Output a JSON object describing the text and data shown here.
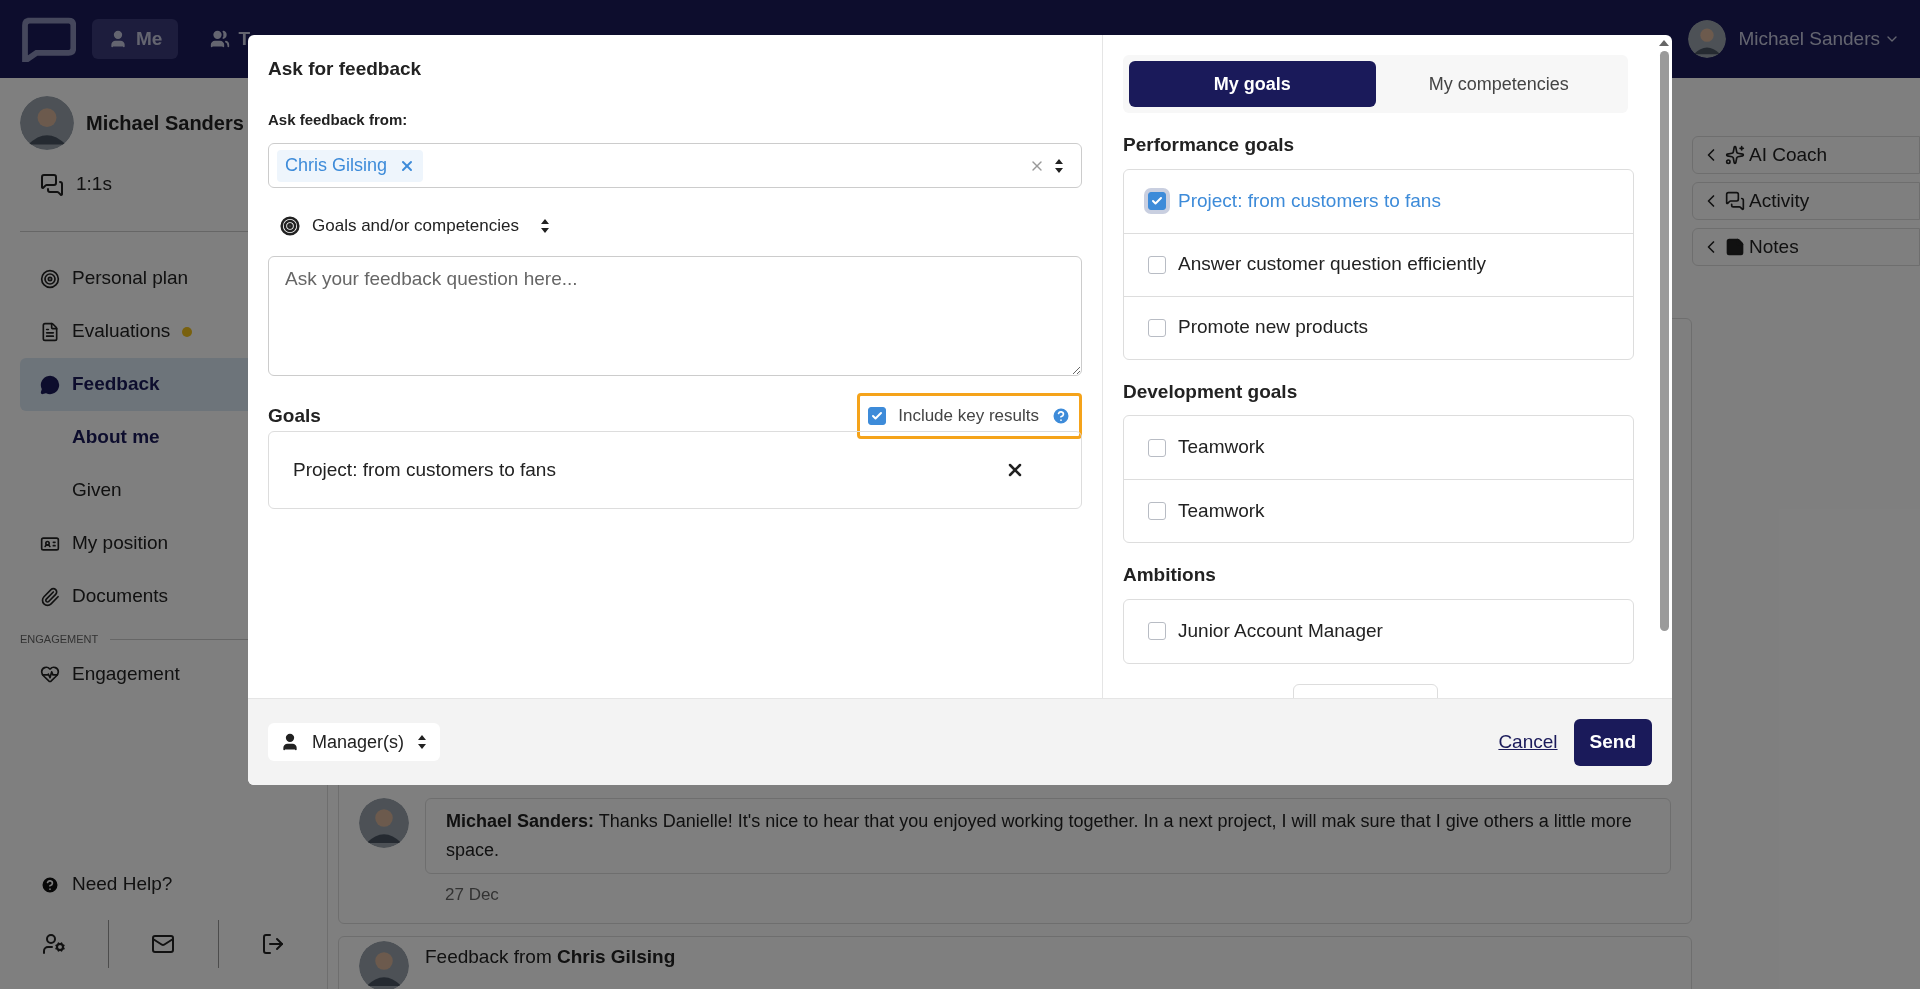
{
  "top_nav": {
    "tabs": [
      {
        "label": "Me",
        "kind": "me",
        "selected": true
      },
      {
        "label": "T",
        "kind": "team",
        "selected": false
      }
    ],
    "user": {
      "name": "Michael Sanders"
    }
  },
  "sidebar": {
    "profile": {
      "name": "Michael Sanders"
    },
    "top_item": {
      "label": "1:1s",
      "kind": "chats"
    },
    "items": [
      {
        "label": "Personal plan",
        "kind": "target",
        "selected": false,
        "notification": false
      },
      {
        "label": "Evaluations",
        "kind": "file",
        "selected": false,
        "notification": true
      },
      {
        "label": "Feedback",
        "kind": "chat",
        "selected": true,
        "notification": false,
        "children": [
          {
            "label": "About me",
            "selected": true
          },
          {
            "label": "Given",
            "selected": false
          }
        ]
      },
      {
        "label": "My position",
        "kind": "id",
        "selected": false,
        "notification": false
      },
      {
        "label": "Documents",
        "kind": "clip",
        "selected": false,
        "notification": false
      }
    ],
    "section_label": "ENGAGEMENT",
    "section_items": [
      {
        "label": "Engagement",
        "kind": "heart",
        "selected": false,
        "notification": false
      }
    ],
    "help": "Need Help?"
  },
  "side_panels": [
    {
      "label": "AI Coach",
      "kind": "sparkles"
    },
    {
      "label": "Activity",
      "kind": "chats"
    },
    {
      "label": "Notes",
      "kind": "note"
    }
  ],
  "comment": {
    "author": "Michael Sanders:",
    "text": "Thanks Danielle! It's nice to hear that you enjoyed working together. In a next project, I will mak sure that I give others a little more space.",
    "date": "27 Dec"
  },
  "next_card": {
    "title": "Feedback from **Chris Gilsing**"
  },
  "dialog": {
    "title": "Ask for feedback",
    "from_label": "Ask feedback from:",
    "recipients": [
      "Chris Gilsing"
    ],
    "type_select": "Goals and/or competencies",
    "question": {
      "placeholder": "Ask your feedback question here..."
    },
    "goals_heading": "Goals",
    "include_key_results": {
      "label": "Include key results",
      "checked": true,
      "highlighted": true
    },
    "selected_goals": [
      "Project: from customers to fans"
    ],
    "tabs": [
      {
        "label": "My goals",
        "selected": true
      },
      {
        "label": "My competencies",
        "selected": false
      }
    ],
    "groups": [
      {
        "heading": "Performance goals",
        "items": [
          {
            "label": "Project: from customers to fans",
            "checked": true
          },
          {
            "label": "Answer customer question efficiently",
            "checked": false
          },
          {
            "label": "Promote new products",
            "checked": false
          }
        ]
      },
      {
        "heading": "Development goals",
        "items": [
          {
            "label": "Teamwork",
            "checked": false
          },
          {
            "label": "Teamwork",
            "checked": false
          }
        ]
      },
      {
        "heading": "Ambitions",
        "items": [
          {
            "label": "Junior Account Manager",
            "checked": false
          }
        ]
      }
    ],
    "visibility": "Manager(s)",
    "cancel": "Cancel",
    "send": "Send"
  }
}
